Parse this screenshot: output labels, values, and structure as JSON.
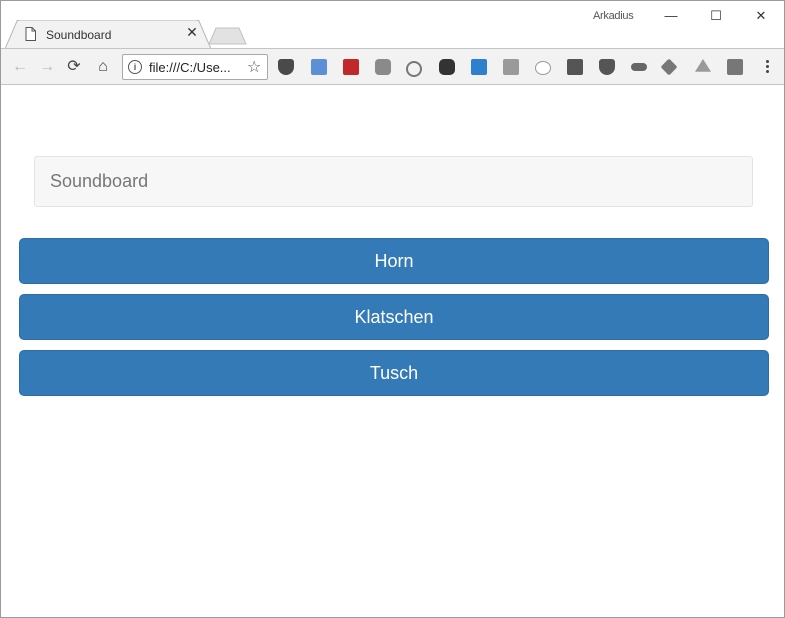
{
  "browser": {
    "tab_title": "Soundboard",
    "tab_close": "✕",
    "profile_name": "Arkadius",
    "window_controls": {
      "minimize": "—",
      "maximize": "☐",
      "close": "✕"
    },
    "address": "file:///C:/Use...",
    "nav": {
      "back": "←",
      "forward": "→",
      "reload": "⟳",
      "home": "⌂"
    },
    "star": "☆",
    "extensions": [
      "pocket-icon",
      "screenshot-icon",
      "lastpass-icon",
      "camera-icon",
      "broadcast-icon",
      "evernote-icon",
      "gliffy-icon",
      "grid-icon",
      "speech-bubble-icon",
      "jb-icon",
      "ublock-icon",
      "car-icon",
      "hexagon-icon",
      "drive-icon",
      "puzzle-icon"
    ]
  },
  "page": {
    "heading_field": "Soundboard",
    "buttons": [
      {
        "label": "Horn"
      },
      {
        "label": "Klatschen"
      },
      {
        "label": "Tusch"
      }
    ]
  },
  "colors": {
    "button_primary": "#337ab7",
    "button_border": "#2e6da4",
    "field_bg": "#f7f7f7"
  }
}
